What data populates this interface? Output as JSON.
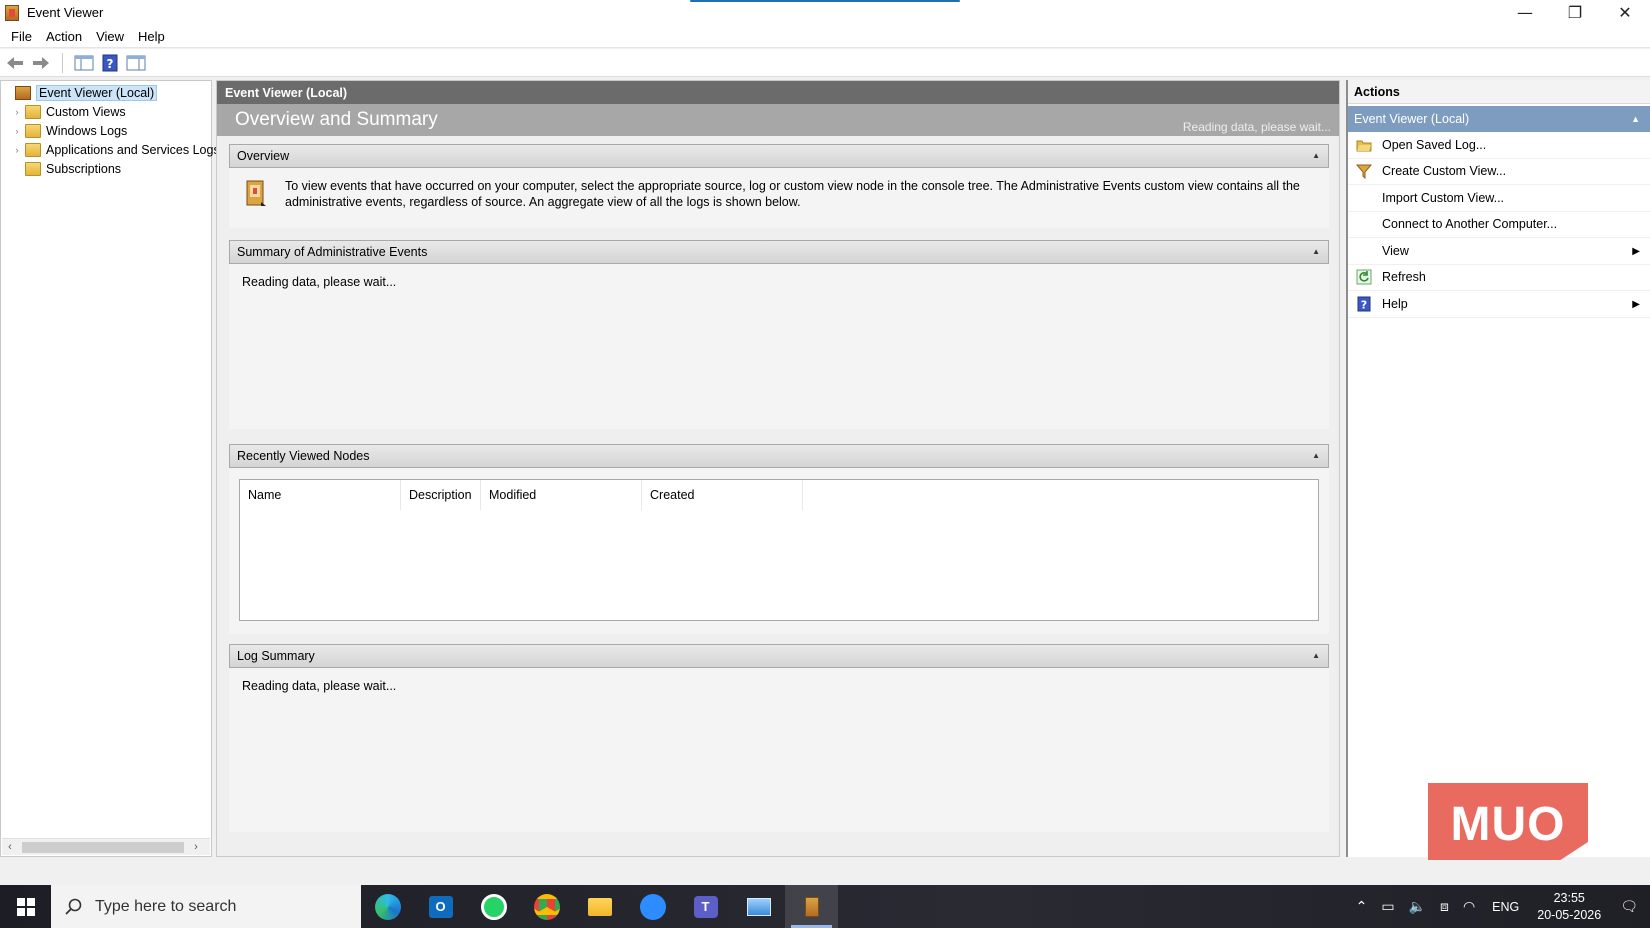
{
  "window": {
    "title": "Event Viewer",
    "controls": {
      "minimize": "—",
      "restore": "❐",
      "close": "✕"
    }
  },
  "menu": [
    "File",
    "Action",
    "View",
    "Help"
  ],
  "tree": {
    "items": [
      {
        "label": "Event Viewer (Local)",
        "selected": true
      },
      {
        "label": "Custom Views"
      },
      {
        "label": "Windows Logs"
      },
      {
        "label": "Applications and Services Logs"
      },
      {
        "label": "Subscriptions"
      }
    ]
  },
  "center": {
    "header": "Event Viewer (Local)",
    "banner_title": "Overview and Summary",
    "banner_status": "Reading data, please wait...",
    "sections": {
      "overview": {
        "title": "Overview",
        "text": "To view events that have occurred on your computer, select the appropriate source, log or custom view node in the console tree. The Administrative Events custom view contains all the administrative events, regardless of source. An aggregate view of all the logs is shown below."
      },
      "admin_events": {
        "title": "Summary of Administrative Events",
        "status": "Reading data, please wait..."
      },
      "recent_nodes": {
        "title": "Recently Viewed Nodes",
        "columns": [
          "Name",
          "Description",
          "Modified",
          "Created"
        ]
      },
      "log_summary": {
        "title": "Log Summary",
        "status": "Reading data, please wait..."
      }
    }
  },
  "actions": {
    "title": "Actions",
    "group": "Event Viewer (Local)",
    "items": [
      {
        "label": "Open Saved Log...",
        "icon": "folder-open-icon"
      },
      {
        "label": "Create Custom View...",
        "icon": "filter-icon"
      },
      {
        "label": "Import Custom View...",
        "icon": ""
      },
      {
        "label": "Connect to Another Computer...",
        "icon": ""
      },
      {
        "label": "View",
        "icon": "",
        "submenu": true
      },
      {
        "label": "Refresh",
        "icon": "refresh-icon"
      },
      {
        "label": "Help",
        "icon": "help-icon",
        "submenu": true
      }
    ]
  },
  "watermark": "MUO",
  "taskbar": {
    "search_placeholder": "Type here to search",
    "language": "ENG",
    "time": "23:55",
    "date": "20-05-2026"
  },
  "colors": {
    "section_header_accent": "#7e9cc0",
    "center_header": "#6b6b6b",
    "banner": "#a7a7a7",
    "watermark": "#e96a5f"
  }
}
